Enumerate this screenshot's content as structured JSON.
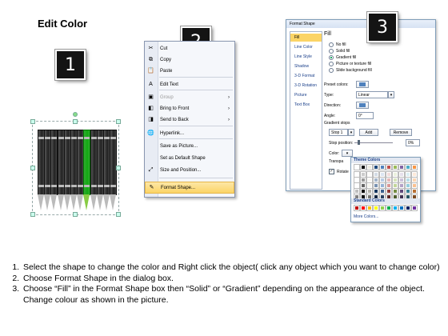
{
  "page": {
    "title": "Edit Color"
  },
  "badges": [
    "1",
    "2",
    "3"
  ],
  "context_menu": {
    "items": [
      {
        "label": "Cut",
        "icon": "scissors-icon",
        "disabled": false,
        "submenu": false
      },
      {
        "label": "Copy",
        "icon": "copy-icon",
        "disabled": false,
        "submenu": false
      },
      {
        "label": "Paste",
        "icon": "paste-icon",
        "disabled": false,
        "submenu": false
      },
      {
        "label": "Edit Text",
        "icon": "edit-text-icon",
        "disabled": false,
        "submenu": false
      },
      {
        "label": "Group",
        "icon": "group-icon",
        "disabled": true,
        "submenu": true
      },
      {
        "label": "Bring to Front",
        "icon": "bring-front-icon",
        "disabled": false,
        "submenu": true
      },
      {
        "label": "Send to Back",
        "icon": "send-back-icon",
        "disabled": false,
        "submenu": true
      },
      {
        "label": "Hyperlink...",
        "icon": "hyperlink-icon",
        "disabled": false,
        "submenu": false
      },
      {
        "label": "Save as Picture...",
        "icon": "",
        "disabled": false,
        "submenu": false
      },
      {
        "label": "Set as Default Shape",
        "icon": "",
        "disabled": false,
        "submenu": false
      },
      {
        "label": "Size and Position...",
        "icon": "size-icon",
        "disabled": false,
        "submenu": false
      },
      {
        "label": "Format Shape...",
        "icon": "format-shape-icon",
        "disabled": false,
        "submenu": false,
        "selected": true
      }
    ]
  },
  "format_dialog": {
    "title": "Format Shape",
    "categories": [
      "Fill",
      "Line Color",
      "Line Style",
      "Shadow",
      "3-D Format",
      "3-D Rotation",
      "Picture",
      "Text Box"
    ],
    "selected_category": "Fill",
    "section_title": "Fill",
    "fill_options": [
      "No fill",
      "Solid fill",
      "Gradient fill",
      "Picture or texture fill",
      "Slide background fill"
    ],
    "selected_fill": "Gradient fill",
    "preset_colors_label": "Preset colors:",
    "type_label": "Type:",
    "type_value": "Linear",
    "direction_label": "Direction:",
    "angle_label": "Angle:",
    "angle_value": "0°",
    "gradient_stops_label": "Gradient stops",
    "stop_value": "Stop 1",
    "add_label": "Add",
    "remove_label": "Remove",
    "stop_position_label": "Stop position:",
    "stop_position_value": "0%",
    "color_label": "Color:",
    "transparency_label": "Transpa",
    "rotate_label": "Rotate"
  },
  "palette": {
    "theme_header": "Theme Colors",
    "standard_header": "Standard Colors",
    "more_colors": "More Colors...",
    "theme_top": [
      "#ffffff",
      "#000000",
      "#eeece1",
      "#1f497d",
      "#4f81bd",
      "#c0504d",
      "#9bbb59",
      "#8064a2",
      "#4bacc6",
      "#f79646"
    ],
    "standard": [
      "#c00000",
      "#ff0000",
      "#ffc000",
      "#ffff00",
      "#92d050",
      "#00b050",
      "#00b0f0",
      "#0070c0",
      "#002060",
      "#7030a0"
    ]
  },
  "instructions": [
    "Select the shape to change the color and Right click the object( click any object which you want to change color)",
    "Choose Format Shape in the dialog box.",
    "Choose “Fill” in the Format Shape box then “Solid” or “Gradient” depending on the appearance of the object. Change colour as shown in the picture."
  ]
}
